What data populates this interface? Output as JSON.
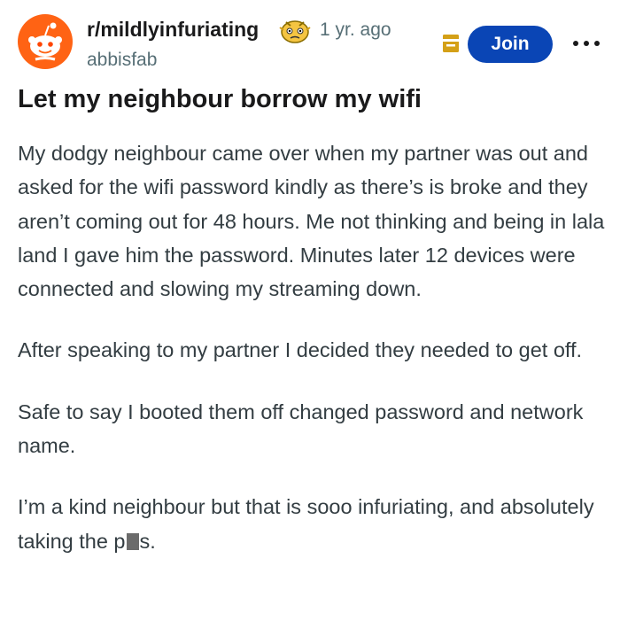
{
  "post": {
    "subreddit": "r/mildlyinfuriating",
    "time_ago": "1 yr. ago",
    "author": "abbisfab",
    "join_label": "Join",
    "title": "Let my neighbour borrow my wifi",
    "paragraphs": [
      "My dodgy neighbour came over when my partner was out and asked for the wifi password kindly as there’s is broke and they aren’t coming out for 48 hours. Me not thinking and being in lala land I gave him the password. Minutes later 12 devices were connected and slowing my streaming down.",
      "After speaking to my partner I decided they needed to get off.",
      "Safe to say I booted them off changed password and network name."
    ],
    "last_paragraph_before": "I’m a kind neighbour but that is sooo infuriating, and absolutely taking the p",
    "last_paragraph_after": "s."
  },
  "icons": {
    "avatar": "reddit-snoo-icon",
    "subreddit_badge": "infuriated-face-icon",
    "flag": "mod-flag-icon",
    "more": "more-options-icon"
  },
  "colors": {
    "avatar_bg": "#ff6314",
    "join_bg": "#0a45b5",
    "meta_text": "#576f76",
    "body_text": "#333d42",
    "flag": "#d4a017"
  }
}
